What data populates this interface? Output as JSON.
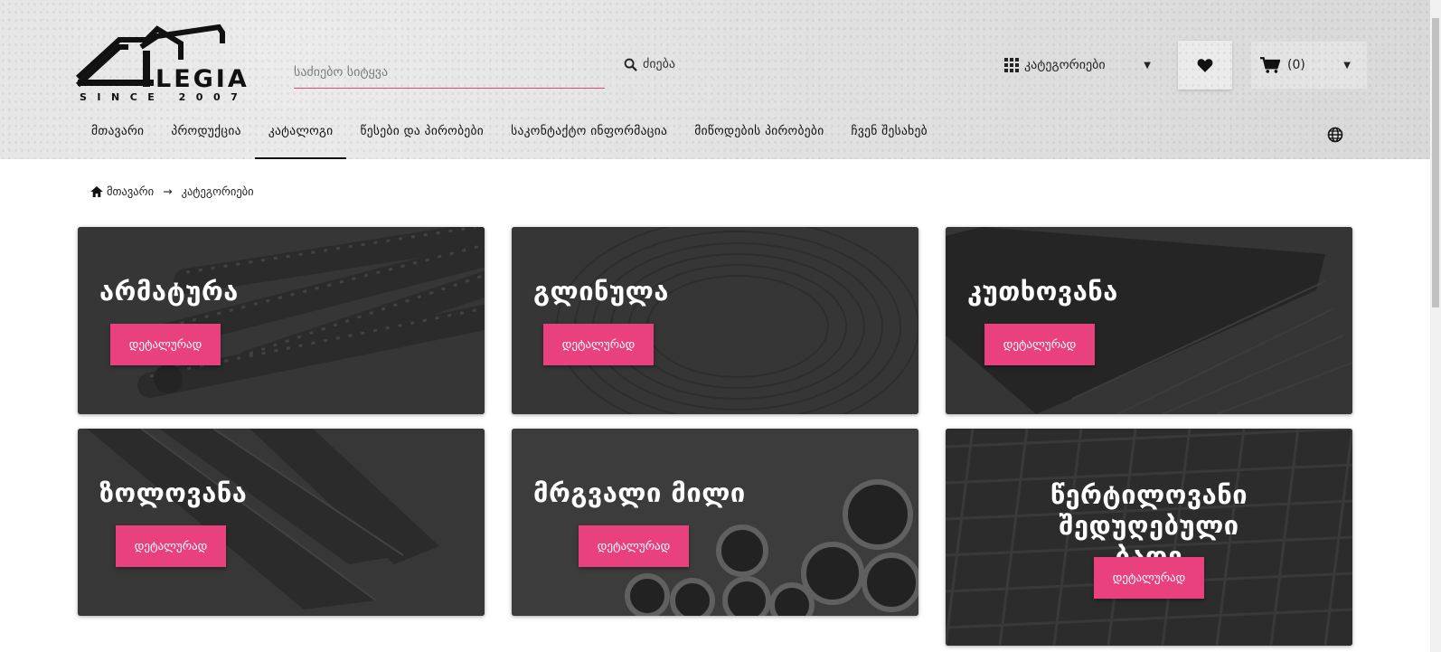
{
  "header": {
    "logo_text": "LEGIA",
    "logo_since": "SINCE 2007",
    "search_placeholder": "საძიებო სიტყვა",
    "search_button": "ძიება",
    "categories_button": "კატეგორიები",
    "cart_count": "(0)"
  },
  "nav": [
    {
      "label": "მთავარი",
      "active": false
    },
    {
      "label": "პროდუქცია",
      "active": false
    },
    {
      "label": "კატალოგი",
      "active": true
    },
    {
      "label": "წესები და პირობები",
      "active": false
    },
    {
      "label": "საკონტაქტო ინფორმაცია",
      "active": false
    },
    {
      "label": "მიწოდების პირობები",
      "active": false
    },
    {
      "label": "ჩვენ შესახებ",
      "active": false
    }
  ],
  "breadcrumb": {
    "home": "მთავარი",
    "current": "კატეგორიები"
  },
  "cards": [
    {
      "title": "არმატურა",
      "button": "დეტალურად",
      "image": "rebar"
    },
    {
      "title": "გლინულა",
      "button": "დეტალურად",
      "image": "wire-coil"
    },
    {
      "title": "კუთხოვანა",
      "button": "დეტალურად",
      "image": "angle-steel"
    },
    {
      "title": "ზოლოვანა",
      "button": "დეტალურად",
      "image": "flat-bar"
    },
    {
      "title": "მრგვალი მილი",
      "button": "დეტალურად",
      "image": "round-pipe"
    },
    {
      "title": "წერტილოვანი შედუღებული ბადე",
      "button": "დეტალურად",
      "image": "welded-mesh"
    }
  ],
  "colors": {
    "accent": "#e8417e",
    "header_bg": "#e0e0e0",
    "card_bg": "#3b3b3b"
  }
}
